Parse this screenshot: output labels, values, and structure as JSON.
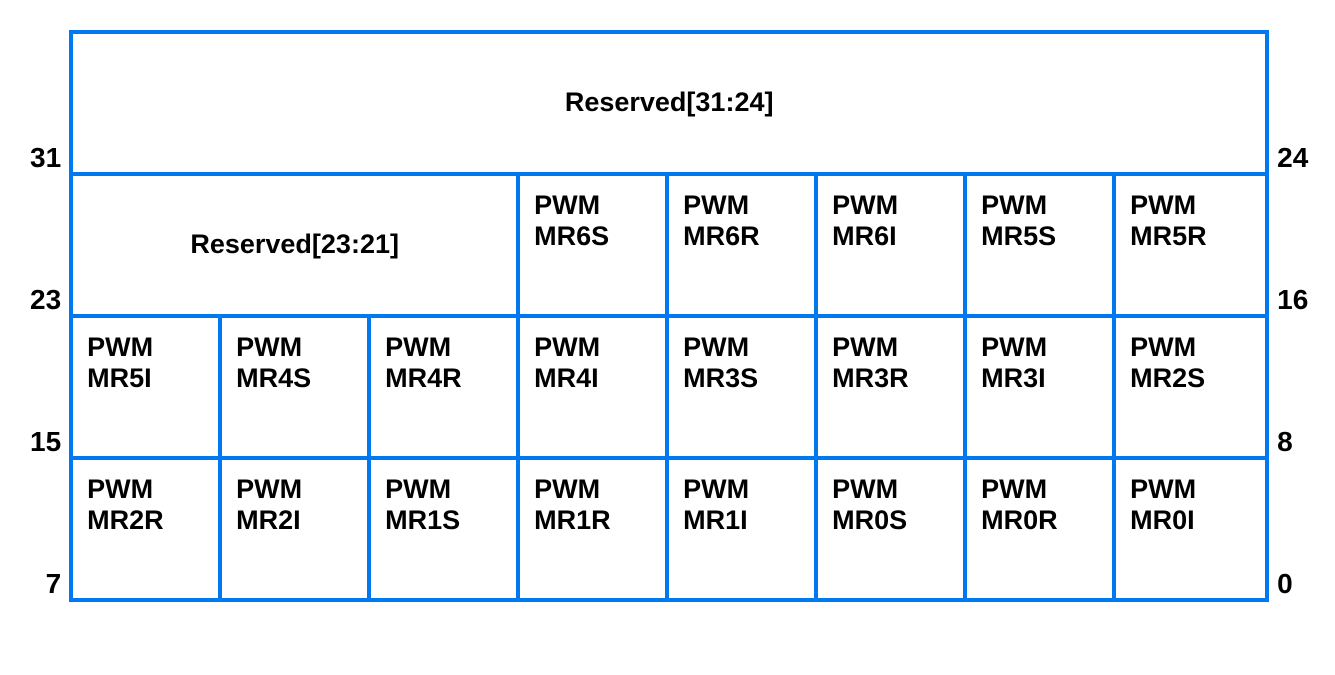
{
  "register": {
    "rows": [
      {
        "left_bit": "31",
        "right_bit": "24",
        "cells": [
          {
            "span": 8,
            "text": "Reserved[31:24]",
            "center": true
          }
        ]
      },
      {
        "left_bit": "23",
        "right_bit": "16",
        "cells": [
          {
            "span": 3,
            "text": "Reserved[23:21]",
            "center": true
          },
          {
            "span": 1,
            "line1": "PWM",
            "line2": "MR6S"
          },
          {
            "span": 1,
            "line1": "PWM",
            "line2": "MR6R"
          },
          {
            "span": 1,
            "line1": "PWM",
            "line2": "MR6I"
          },
          {
            "span": 1,
            "line1": "PWM",
            "line2": "MR5S"
          },
          {
            "span": 1,
            "line1": "PWM",
            "line2": "MR5R"
          }
        ]
      },
      {
        "left_bit": "15",
        "right_bit": "8",
        "cells": [
          {
            "span": 1,
            "line1": "PWM",
            "line2": "MR5I"
          },
          {
            "span": 1,
            "line1": "PWM",
            "line2": "MR4S"
          },
          {
            "span": 1,
            "line1": "PWM",
            "line2": "MR4R"
          },
          {
            "span": 1,
            "line1": "PWM",
            "line2": "MR4I"
          },
          {
            "span": 1,
            "line1": "PWM",
            "line2": "MR3S"
          },
          {
            "span": 1,
            "line1": "PWM",
            "line2": "MR3R"
          },
          {
            "span": 1,
            "line1": "PWM",
            "line2": "MR3I"
          },
          {
            "span": 1,
            "line1": "PWM",
            "line2": "MR2S"
          }
        ]
      },
      {
        "left_bit": "7",
        "right_bit": "0",
        "cells": [
          {
            "span": 1,
            "line1": "PWM",
            "line2": "MR2R"
          },
          {
            "span": 1,
            "line1": "PWM",
            "line2": "MR2I"
          },
          {
            "span": 1,
            "line1": "PWM",
            "line2": "MR1S"
          },
          {
            "span": 1,
            "line1": "PWM",
            "line2": "MR1R"
          },
          {
            "span": 1,
            "line1": "PWM",
            "line2": "MR1I"
          },
          {
            "span": 1,
            "line1": "PWM",
            "line2": "MR0S"
          },
          {
            "span": 1,
            "line1": "PWM",
            "line2": "MR0R"
          },
          {
            "span": 1,
            "line1": "PWM",
            "line2": "MR0I"
          }
        ]
      }
    ]
  }
}
